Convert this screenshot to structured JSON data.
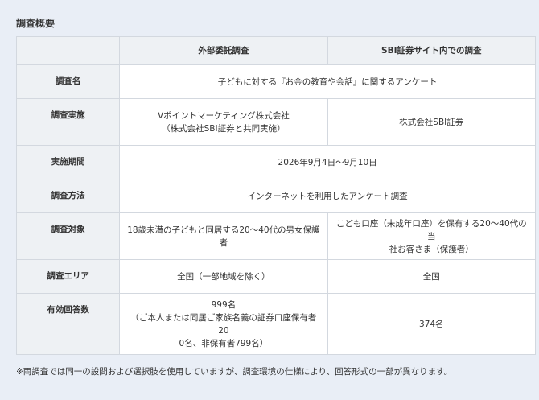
{
  "section_title": "調査概要",
  "table": {
    "headers": [
      "",
      "外部委託調査",
      "SBI証券サイト内での調査"
    ],
    "rows": [
      {
        "label": "調査名",
        "merged": true,
        "a": [
          "子どもに対する『お金の教育や会話』に関するアンケート"
        ]
      },
      {
        "label": "調査実施",
        "merged": false,
        "a": [
          "Vポイントマーケティング株式会社",
          "（株式会社SBI証券と共同実施）"
        ],
        "b": [
          "株式会社SBI証券"
        ]
      },
      {
        "label": "実施期間",
        "merged": true,
        "a": [
          "2026年9月4日〜9月10日"
        ]
      },
      {
        "label": "調査方法",
        "merged": true,
        "a": [
          "インターネットを利用したアンケート調査"
        ]
      },
      {
        "label": "調査対象",
        "merged": false,
        "a": [
          "18歳未満の子どもと同居する20〜40代の男女保護者"
        ],
        "b": [
          "こども口座（未成年口座）を保有する20〜40代の当",
          "社お客さま（保護者）"
        ]
      },
      {
        "label": "調査エリア",
        "merged": false,
        "a": [
          "全国（一部地域を除く）"
        ],
        "b": [
          "全国"
        ]
      },
      {
        "label": "有効回答数",
        "merged": false,
        "a": [
          "999名",
          "（ご本人または同居ご家族名義の証券口座保有者20",
          "0名、非保有者799名）"
        ],
        "b": [
          "374名"
        ]
      }
    ]
  },
  "footnote": "※両調査では同一の設問および選択肢を使用していますが、調査環境の仕様により、回答形式の一部が異なります。"
}
